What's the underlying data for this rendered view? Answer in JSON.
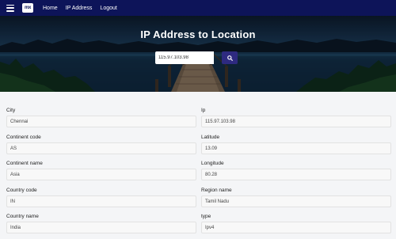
{
  "navbar": {
    "logo_text": "mx",
    "links": [
      "Home",
      "IP Address",
      "Logout"
    ],
    "background": "#0d1459"
  },
  "hero": {
    "title": "IP Address to Location"
  },
  "search": {
    "value": "115.97.103.98",
    "button_icon": "search-icon",
    "button_color": "#2e2a80"
  },
  "fields": {
    "left": [
      {
        "label": "City",
        "value": "Chennai"
      },
      {
        "label": "Continent code",
        "value": "AS"
      },
      {
        "label": "Continent name",
        "value": "Asia"
      },
      {
        "label": "Country code",
        "value": "IN"
      },
      {
        "label": "Country name",
        "value": "India"
      }
    ],
    "right": [
      {
        "label": "Ip",
        "value": "115.97.103.98"
      },
      {
        "label": "Latitude",
        "value": "13.09"
      },
      {
        "label": "Longitude",
        "value": "80.28"
      },
      {
        "label": "Region name",
        "value": "Tamil Nadu"
      },
      {
        "label": "type",
        "value": "Ipv4"
      }
    ]
  }
}
